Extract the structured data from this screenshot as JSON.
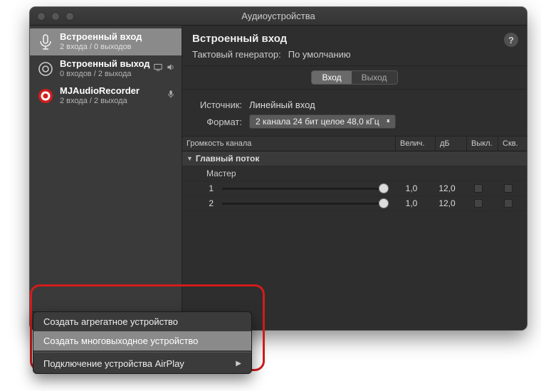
{
  "window": {
    "title": "Аудиоустройства"
  },
  "sidebar": {
    "devices": [
      {
        "name": "Встроенный вход",
        "sub": "2 входа / 0 выходов",
        "selected": true,
        "icon": "mic"
      },
      {
        "name": "Встроенный выход",
        "sub": "0 входов / 2 выхода",
        "selected": false,
        "icon": "speaker",
        "indicators": [
          "display",
          "sound"
        ]
      },
      {
        "name": "MJAudioRecorder",
        "sub": "2 входа / 2 выхода",
        "selected": false,
        "icon": "target",
        "indicators": [
          "mic"
        ]
      }
    ]
  },
  "detail": {
    "title": "Встроенный вход",
    "clock_label": "Тактовый генератор:",
    "clock_value": "По умолчанию",
    "tabs": {
      "input": "Вход",
      "output": "Выход",
      "active": "input"
    },
    "source_label": "Источник:",
    "source_value": "Линейный вход",
    "format_label": "Формат:",
    "format_value": "2 канала 24 бит целое 48,0 кГц",
    "table": {
      "headers": {
        "name": "Громкость канала",
        "val": "Велич.",
        "db": "дБ",
        "mute": "Выкл.",
        "thru": "Скв."
      },
      "stream_label": "Главный поток",
      "master_label": "Мастер",
      "channels": [
        {
          "label": "1",
          "pos": 98,
          "val": "1,0",
          "db": "12,0"
        },
        {
          "label": "2",
          "pos": 98,
          "val": "1,0",
          "db": "12,0"
        }
      ]
    }
  },
  "menu": {
    "aggregate": "Создать агрегатное устройство",
    "multiout": "Создать многовыходное устройство",
    "airplay": "Подключение устройства AirPlay"
  }
}
